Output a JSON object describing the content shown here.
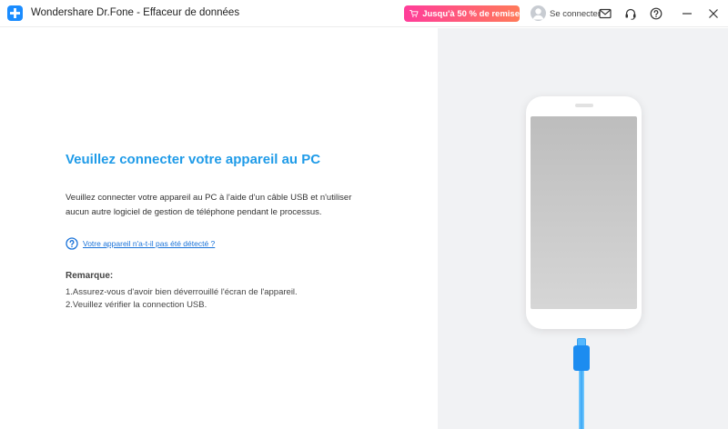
{
  "titlebar": {
    "app_title": "Wondershare Dr.Fone - Effaceur de données",
    "promo_label": "Jusqu'à 50 % de remise",
    "signin_label": "Se connecter"
  },
  "main": {
    "heading": "Veuillez connecter votre appareil au PC",
    "description_line1": "Veuillez connecter votre appareil au PC à l'aide d'un câble USB et n'utiliser",
    "description_line2": "aucun autre logiciel de gestion de téléphone pendant le processus.",
    "help_link": "Votre appareil n'a-t-il pas été détecté ?",
    "remark_title": "Remarque:",
    "remarks": [
      "1.Assurez-vous d'avoir bien déverrouillé l'écran de l'appareil.",
      "2.Veuillez vérifier la connection USB."
    ]
  },
  "colors": {
    "accent": "#1f9be8",
    "link": "#1a73d9",
    "promo_start": "#ff3d9a",
    "promo_end": "#ff7a59",
    "cable": "#1c8cf0",
    "panel_bg": "#f1f2f4"
  },
  "icons": {
    "app_logo": "plus-cross-logo",
    "promo": "cart-icon",
    "avatar": "user-avatar-icon",
    "mail": "mail-icon",
    "support": "headset-icon",
    "help": "question-circle-icon",
    "minimize": "minimize-icon",
    "close": "close-icon",
    "help_link": "question-circle-icon"
  }
}
